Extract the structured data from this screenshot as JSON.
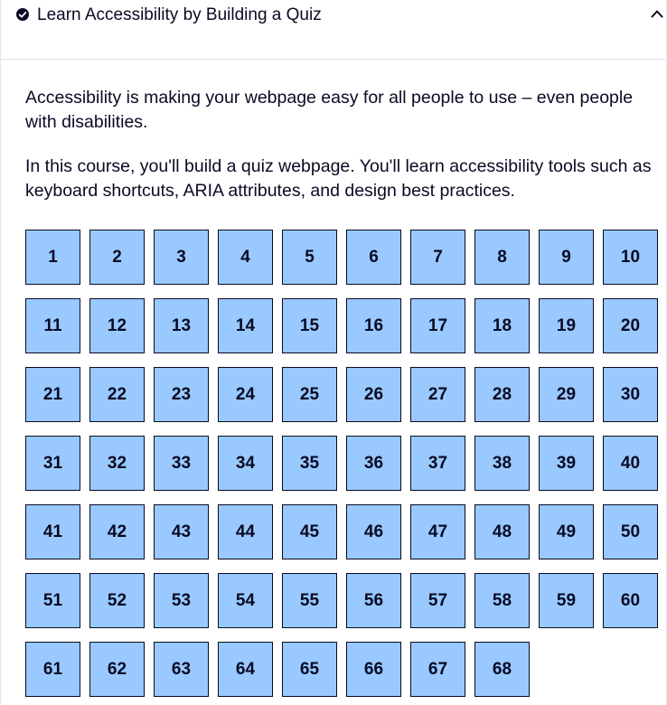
{
  "block": {
    "title": "Learn Accessibility by Building a Quiz",
    "completed_icon": "check-circle-icon",
    "toggle_icon": "caret-up-icon",
    "description": [
      "Accessibility is making your webpage easy for all people to use – even people with disabilities.",
      "In this course, you'll build a quiz webpage. You'll learn accessibility tools such as keyboard shortcuts, ARIA attributes, and design best practices."
    ]
  },
  "steps": [
    "1",
    "2",
    "3",
    "4",
    "5",
    "6",
    "7",
    "8",
    "9",
    "10",
    "11",
    "12",
    "13",
    "14",
    "15",
    "16",
    "17",
    "18",
    "19",
    "20",
    "21",
    "22",
    "23",
    "24",
    "25",
    "26",
    "27",
    "28",
    "29",
    "30",
    "31",
    "32",
    "33",
    "34",
    "35",
    "36",
    "37",
    "38",
    "39",
    "40",
    "41",
    "42",
    "43",
    "44",
    "45",
    "46",
    "47",
    "48",
    "49",
    "50",
    "51",
    "52",
    "53",
    "54",
    "55",
    "56",
    "57",
    "58",
    "59",
    "60",
    "61",
    "62",
    "63",
    "64",
    "65",
    "66",
    "67",
    "68"
  ],
  "colors": {
    "step_background": "#99c9ff",
    "step_border": "#0a0a23",
    "text": "#0a0a23",
    "divider": "#e4e4ea"
  }
}
